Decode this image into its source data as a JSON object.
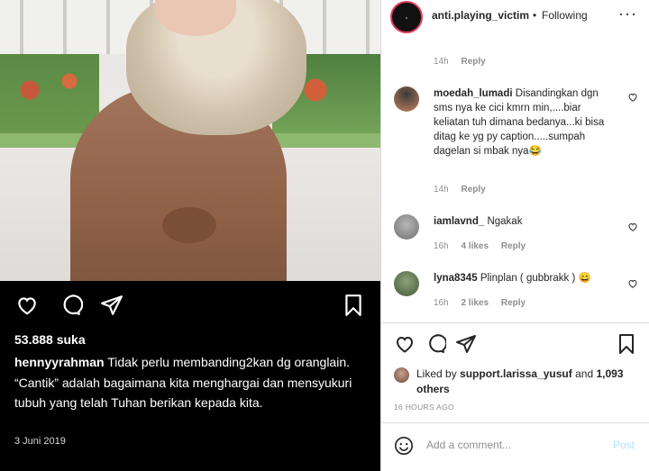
{
  "left_post": {
    "likes": "53.888 suka",
    "caption_user": "hennyyrahman",
    "caption_text": "Tidak perlu membanding2kan dg oranglain. “Cantik” adalah bagaimana kita menghargai dan mensyukuri tubuh yang telah Tuhan berikan kepada kita.",
    "date": "3 Juni 2019",
    "icons": [
      "heart-icon",
      "comment-icon",
      "share-icon",
      "bookmark-icon"
    ]
  },
  "header": {
    "username": "anti.playing_victim",
    "separator": "•",
    "follow_state": "Following",
    "more": "···"
  },
  "comments": [
    {
      "id": "c0",
      "time": "14h",
      "reply": "Reply"
    },
    {
      "id": "c1",
      "user": "moedah_lumadi",
      "text": "Disandingkan dgn sms nya ke cici kmrn min,....biar keliatan tuh dimana bedanya...ki bisa ditag ke yg py caption.....sumpah dagelan si mbak nya😂",
      "time": "14h",
      "reply": "Reply"
    },
    {
      "id": "c2",
      "user": "iamlavnd_",
      "text": "Ngakak",
      "time": "16h",
      "likes": "4 likes",
      "reply": "Reply"
    },
    {
      "id": "c3",
      "user": "lyna8345",
      "text": "Plinplan ( gubbrakk ) 😄",
      "time": "16h",
      "likes": "2 likes",
      "reply": "Reply"
    }
  ],
  "liked_by": {
    "prefix": "Liked by",
    "user": "support.larissa_yusuf",
    "joiner": "and",
    "others": "1,093 others"
  },
  "time_ago": "16 HOURS AGO",
  "add_comment": {
    "placeholder": "Add a comment...",
    "post_label": "Post"
  },
  "colors": {
    "story_ring": "#e03b5d",
    "post_button_disabled": "#b2dffc",
    "muted_text": "#8e8e8e"
  }
}
